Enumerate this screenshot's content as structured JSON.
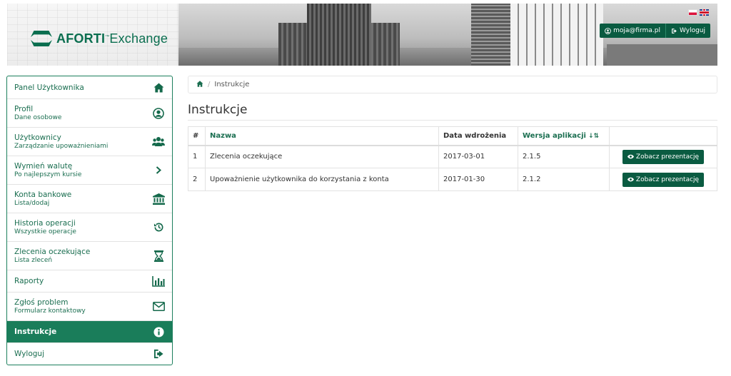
{
  "header": {
    "brand_bold": "AFORTI",
    "brand_rest": "Exchange",
    "user_email": "moja@firma.pl",
    "logout_label": "Wyloguj",
    "languages": [
      "pl",
      "en"
    ]
  },
  "sidebar": {
    "items": [
      {
        "title": "Panel Użytkownika",
        "sub": "",
        "icon": "home-icon"
      },
      {
        "title": "Profil",
        "sub": "Dane osobowe",
        "icon": "user-circle-icon"
      },
      {
        "title": "Użytkownicy",
        "sub": "Zarządzanie upoważnieniami",
        "icon": "users-icon"
      },
      {
        "title": "Wymień walutę",
        "sub": "Po najlepszym kursie",
        "icon": "chevron-right-icon"
      },
      {
        "title": "Konta bankowe",
        "sub": "Lista/dodaj",
        "icon": "bank-icon"
      },
      {
        "title": "Historia operacji",
        "sub": "Wszystkie operacje",
        "icon": "history-icon"
      },
      {
        "title": "Zlecenia oczekujące",
        "sub": "Lista zleceń",
        "icon": "hourglass-icon"
      },
      {
        "title": "Raporty",
        "sub": "",
        "icon": "bar-chart-icon"
      },
      {
        "title": "Zgłoś problem",
        "sub": "Formularz kontaktowy",
        "icon": "envelope-icon"
      },
      {
        "title": "Instrukcje",
        "sub": "",
        "icon": "info-icon"
      },
      {
        "title": "Wyloguj",
        "sub": "",
        "icon": "sign-out-icon"
      }
    ],
    "active_index": 9
  },
  "breadcrumb": {
    "current": "Instrukcje"
  },
  "page": {
    "title": "Instrukcje"
  },
  "table": {
    "headers": [
      "#",
      "Nazwa",
      "Data wdrożenia",
      "Wersja aplikacji",
      ""
    ],
    "rows": [
      {
        "num": "1",
        "name": "Zlecenia oczekujące",
        "date": "2017-03-01",
        "version": "2.1.5",
        "action": "Zobacz prezentację"
      },
      {
        "num": "2",
        "name": "Upoważnienie użytkownika do korzystania z konta",
        "date": "2017-01-30",
        "version": "2.1.2",
        "action": "Zobacz prezentację"
      }
    ]
  },
  "colors": {
    "brand_green": "#0a6e4f",
    "active_green": "#1a7d5a",
    "button_green": "#0a5b41"
  }
}
